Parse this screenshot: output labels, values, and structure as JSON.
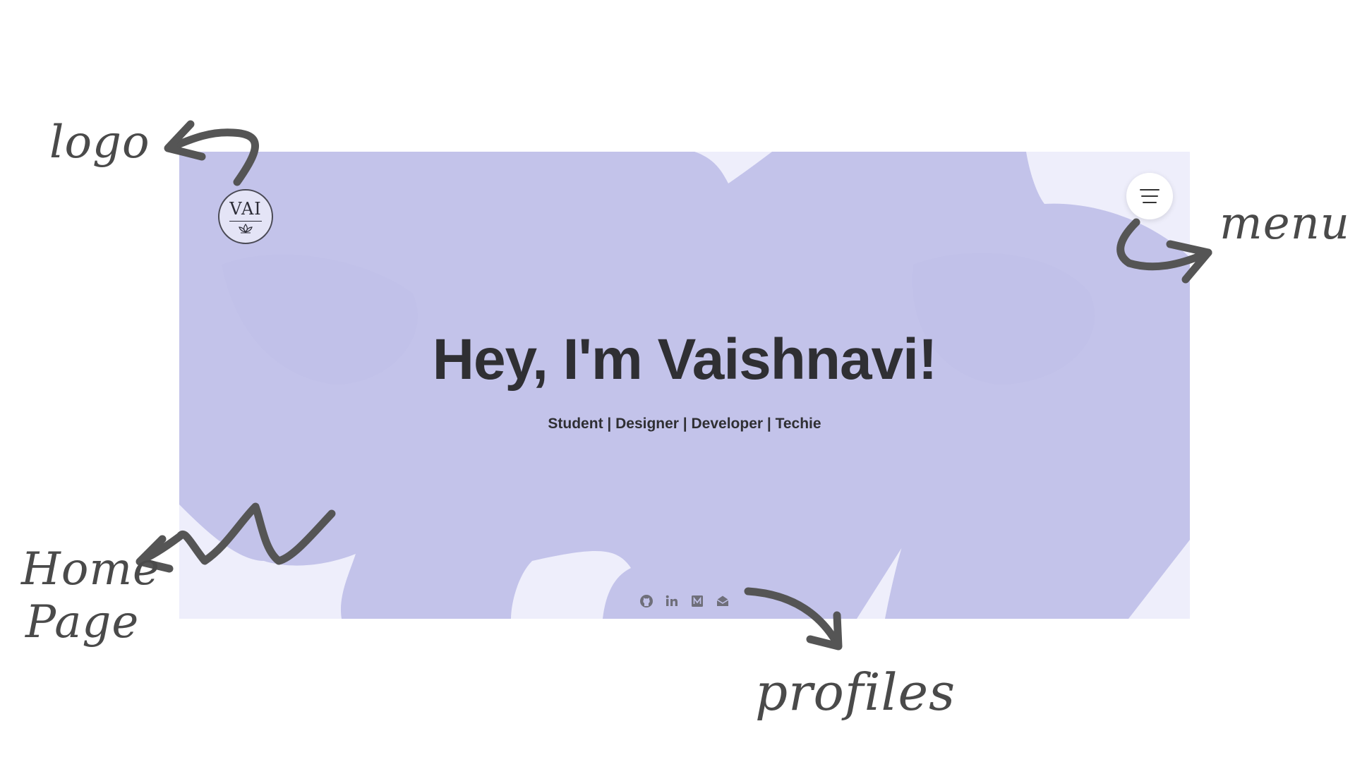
{
  "annotations": {
    "logo": "logo",
    "menu": "menu",
    "home_page_line1": "Home",
    "home_page_line2": "Page",
    "profiles": "profiles"
  },
  "site": {
    "logo": {
      "text": "VAI",
      "icon": "lotus-icon"
    },
    "menu": {
      "icon": "hamburger-icon"
    },
    "hero": {
      "title": "Hey, I'm Vaishnavi!",
      "subtitle": "Student | Designer | Developer | Techie"
    },
    "profiles": [
      {
        "icon": "github-icon"
      },
      {
        "icon": "linkedin-icon"
      },
      {
        "icon": "medium-icon"
      },
      {
        "icon": "mail-icon"
      }
    ],
    "colors": {
      "background": "#eeeefb",
      "blob": "#c3c3ea",
      "text": "#2f2f33",
      "annotation": "#4a4a4a"
    }
  }
}
